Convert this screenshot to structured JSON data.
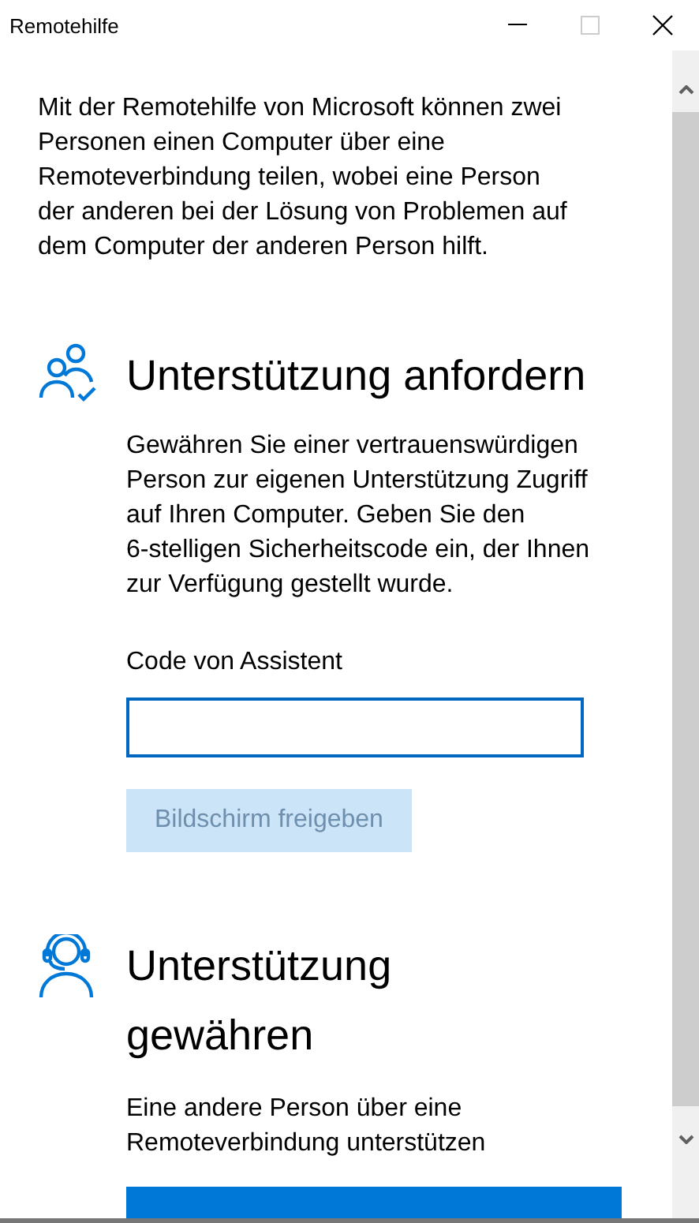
{
  "window": {
    "title": "Remotehilfe"
  },
  "intro": [
    "Mit der Remotehilfe von Microsoft können zwei",
    "Personen einen Computer über eine",
    "Remoteverbindung teilen, wobei eine Person",
    "der anderen bei der Lösung von Problemen auf",
    "dem Computer der anderen Person hilft."
  ],
  "sections": [
    {
      "kind": "request",
      "heading": [
        "Unterstützung anfordern"
      ],
      "text": [
        "Gewähren Sie einer vertrauenswürdigen",
        "Person zur eigenen Unterstützung Zugriff",
        "auf Ihren Computer. Geben Sie den",
        "6-stelligen Sicherheitscode ein, der Ihnen",
        "zur Verfügung gestellt wurde."
      ],
      "field": {
        "label": "Code von Assistent"
      },
      "button": {
        "label": "Bildschirm freigeben",
        "disabled": true
      }
    },
    {
      "kind": "give",
      "heading": [
        "Unterstützung",
        "gewähren"
      ],
      "text": [
        "Eine andere Person über eine",
        "Remoteverbindung unterstützen"
      ],
      "button": {
        "disabled": false
      }
    }
  ]
}
